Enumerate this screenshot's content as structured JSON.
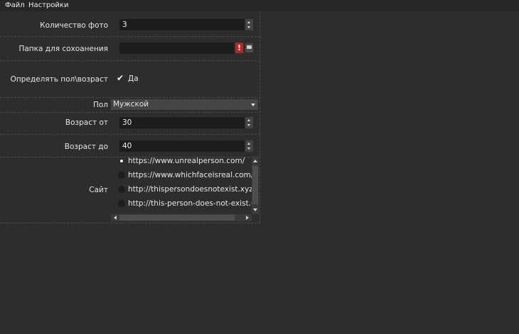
{
  "menu": {
    "file": "Файл",
    "settings": "Настройки"
  },
  "form": {
    "photo_count": {
      "label": "Количество фото",
      "value": "3"
    },
    "save_folder": {
      "label": "Папка для сохоанения",
      "value": "",
      "error_mark": "!"
    },
    "detect": {
      "label": "Определять пол\\возраст",
      "checkbox_label": "Да",
      "checked": true
    },
    "gender": {
      "label": "Пол",
      "value": "Мужской"
    },
    "age_from": {
      "label": "Возраст от",
      "value": "30"
    },
    "age_to": {
      "label": "Возраст до",
      "value": "40"
    },
    "site": {
      "label": "Сайт",
      "options": [
        {
          "text": "https://www.unrealperson.com/",
          "selected": true
        },
        {
          "text": "https://www.whichfaceisreal.com/index.php",
          "selected": false
        },
        {
          "text": "http://thispersondoesnotexist.xyz/",
          "selected": false
        },
        {
          "text": "http://this-person-does-not-exist.com",
          "selected": false
        }
      ]
    }
  }
}
